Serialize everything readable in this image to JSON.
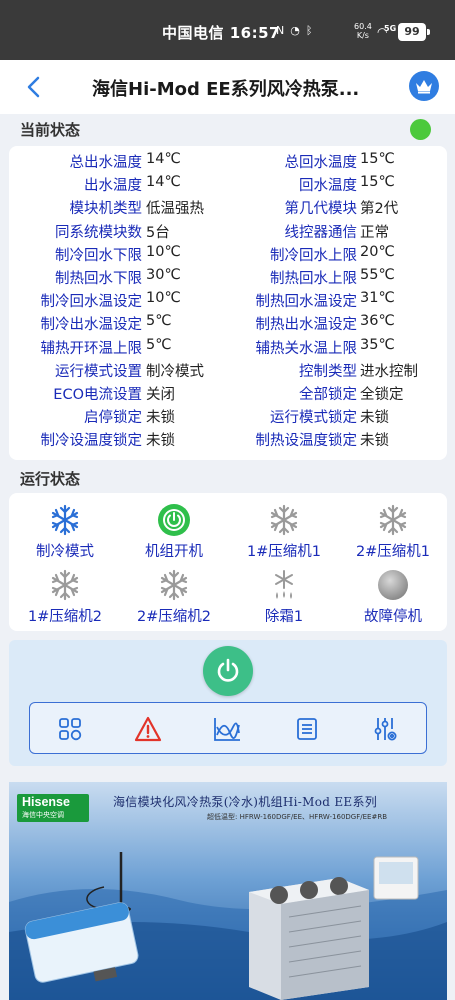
{
  "status_bar": {
    "carrier_time": "中国电信 16:57",
    "speed": "60.4",
    "speed_unit": "K/s",
    "signal": "5G",
    "battery": "99"
  },
  "header": {
    "title": "海信Hi-Mod EE系列风冷热泵..."
  },
  "current_status": {
    "title": "当前状态",
    "indicator_color": "#4cc93c",
    "rows": [
      {
        "l1": "总出水温度",
        "v1": "14℃",
        "l2": "总回水温度",
        "v2": "15℃"
      },
      {
        "l1": "出水温度",
        "v1": "14℃",
        "l2": "回水温度",
        "v2": "15℃"
      },
      {
        "l1": "模块机类型",
        "v1": "低温强热",
        "l2": "第几代模块",
        "v2": "第2代"
      },
      {
        "l1": "同系统模块数",
        "v1": "5台",
        "l2": "线控器通信",
        "v2": "正常"
      },
      {
        "l1": "制冷回水下限",
        "v1": "10℃",
        "l2": "制冷回水上限",
        "v2": "20℃"
      },
      {
        "l1": "制热回水下限",
        "v1": "30℃",
        "l2": "制热回水上限",
        "v2": "55℃"
      },
      {
        "l1": "制冷回水温设定",
        "v1": "10℃",
        "l2": "制热回水温设定",
        "v2": "31℃"
      },
      {
        "l1": "制冷出水温设定",
        "v1": "5℃",
        "l2": "制热出水温设定",
        "v2": "36℃"
      },
      {
        "l1": "辅热开环温上限",
        "v1": "5℃",
        "l2": "辅热关水温上限",
        "v2": "35℃"
      },
      {
        "l1": "运行模式设置",
        "v1": "制冷模式",
        "l2": "控制类型",
        "v2": "进水控制"
      },
      {
        "l1": "ECO电流设置",
        "v1": "关闭",
        "l2": "全部锁定",
        "v2": "全锁定"
      },
      {
        "l1": "启停锁定",
        "v1": "未锁",
        "l2": "运行模式锁定",
        "v2": "未锁"
      },
      {
        "l1": "制冷设温度锁定",
        "v1": "未锁",
        "l2": "制热设温度锁定",
        "v2": "未锁"
      }
    ]
  },
  "run_status": {
    "title": "运行状态",
    "items": [
      {
        "label": "制冷模式",
        "icon": "snowflake-icon",
        "active": true
      },
      {
        "label": "机组开机",
        "icon": "power-icon",
        "active": true
      },
      {
        "label": "1#压缩机1",
        "icon": "snowflake-icon",
        "active": false
      },
      {
        "label": "2#压缩机1",
        "icon": "snowflake-icon",
        "active": false
      },
      {
        "label": "1#压缩机2",
        "icon": "snowflake-icon",
        "active": false
      },
      {
        "label": "2#压缩机2",
        "icon": "snowflake-icon",
        "active": false
      },
      {
        "label": "除霜1",
        "icon": "defrost-icon",
        "active": false
      },
      {
        "label": "故障停机",
        "icon": "fault-icon",
        "active": false
      }
    ]
  },
  "controls": {
    "buttons": [
      "grid-icon",
      "warning-icon",
      "chart-icon",
      "list-icon",
      "settings-sliders-icon"
    ]
  },
  "banner": {
    "brand": "Hisense",
    "brand_sub": "海信中央空调",
    "title": "海信模块化风冷热泵(冷水)机组Hi-Mod EE系列",
    "subtitle": "超低温型:  HFRW-160DGF/EE、HFRW-160DGF/EE#RB"
  },
  "colors": {
    "accent_blue": "#2f7de1",
    "label_blue": "#1a2bb8",
    "active_green": "#2fbf4b",
    "icon_blue": "#2a6fd6",
    "inactive_gray": "#9a9a9a",
    "warning_red": "#e2342a"
  }
}
